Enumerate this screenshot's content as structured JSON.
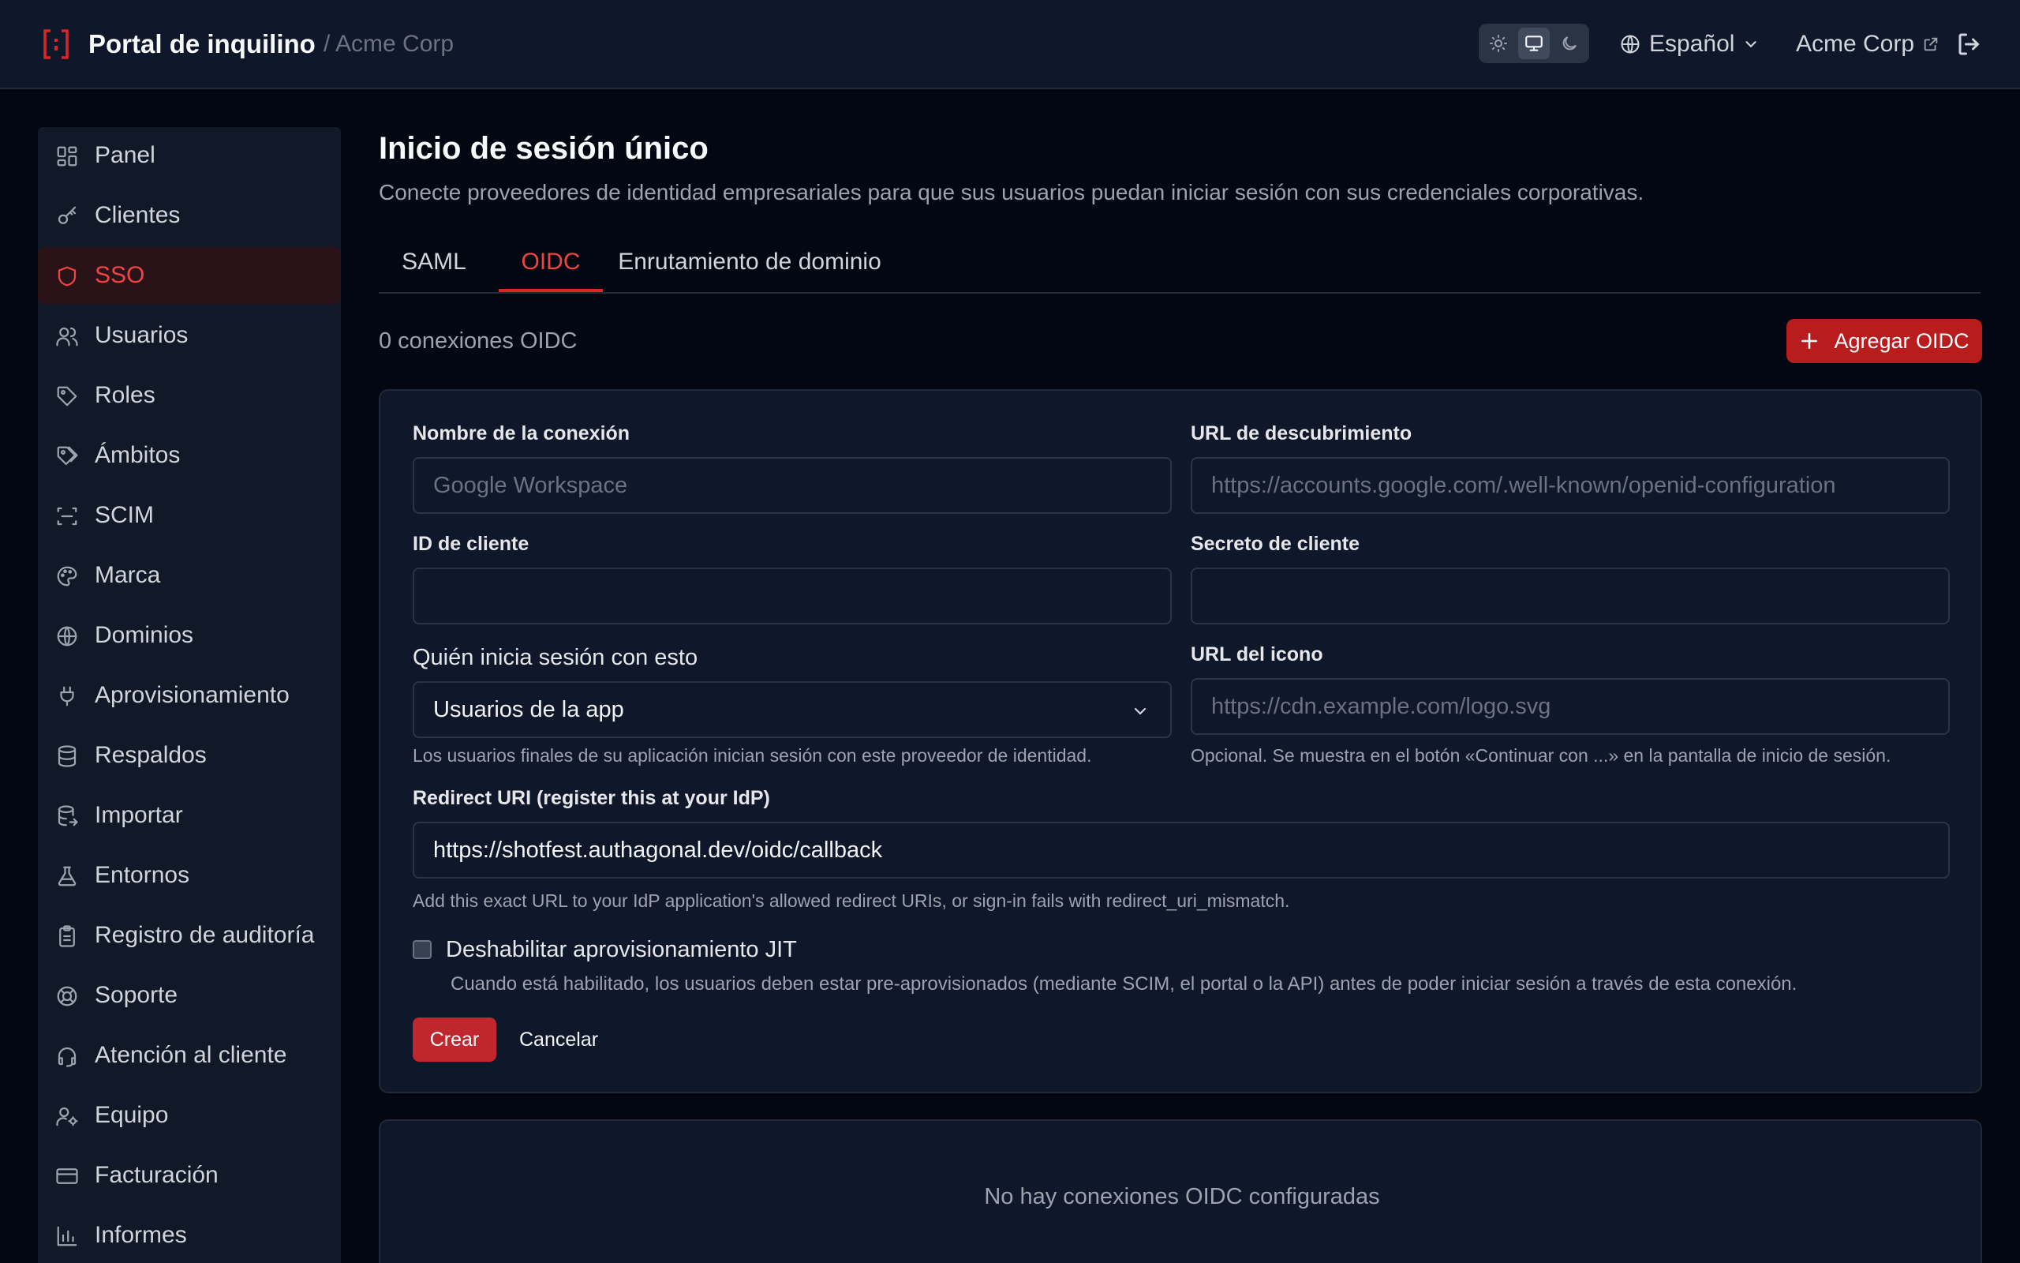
{
  "header": {
    "title": "Portal de inquilino",
    "breadcrumb": "/ Acme Corp",
    "theme_modes": [
      "light",
      "system",
      "dark"
    ],
    "theme_active": "system",
    "language": "Español",
    "org_name": "Acme Corp"
  },
  "sidebar": {
    "items": [
      {
        "label": "Panel",
        "icon": "dashboard-icon"
      },
      {
        "label": "Clientes",
        "icon": "key-icon"
      },
      {
        "label": "SSO",
        "icon": "shield-icon",
        "active": true
      },
      {
        "label": "Usuarios",
        "icon": "users-icon"
      },
      {
        "label": "Roles",
        "icon": "tag-icon"
      },
      {
        "label": "Ámbitos",
        "icon": "tags-icon"
      },
      {
        "label": "SCIM",
        "icon": "scan-icon"
      },
      {
        "label": "Marca",
        "icon": "palette-icon"
      },
      {
        "label": "Dominios",
        "icon": "globe-icon"
      },
      {
        "label": "Aprovisionamiento",
        "icon": "plug-icon"
      },
      {
        "label": "Respaldos",
        "icon": "database-icon"
      },
      {
        "label": "Importar",
        "icon": "database-import-icon"
      },
      {
        "label": "Entornos",
        "icon": "flask-icon"
      },
      {
        "label": "Registro de auditoría",
        "icon": "clipboard-icon"
      },
      {
        "label": "Soporte",
        "icon": "lifebuoy-icon"
      },
      {
        "label": "Atención al cliente",
        "icon": "headset-icon"
      },
      {
        "label": "Equipo",
        "icon": "user-gear-icon"
      },
      {
        "label": "Facturación",
        "icon": "credit-card-icon"
      },
      {
        "label": "Informes",
        "icon": "chart-icon"
      }
    ]
  },
  "page": {
    "title": "Inicio de sesión único",
    "description": "Conecte proveedores de identidad empresariales para que sus usuarios puedan iniciar sesión con sus credenciales corporativas.",
    "tabs": [
      "SAML",
      "OIDC",
      "Enrutamiento de dominio"
    ],
    "active_tab": "OIDC",
    "count_text": "0 conexiones OIDC",
    "add_button": "Agregar OIDC"
  },
  "form": {
    "connection_name_label": "Nombre de la conexión",
    "connection_name_placeholder": "Google Workspace",
    "discovery_url_label": "URL de descubrimiento",
    "discovery_url_placeholder": "https://accounts.google.com/.well-known/openid-configuration",
    "client_id_label": "ID de cliente",
    "client_id_value": "",
    "client_secret_label": "Secreto de cliente",
    "client_secret_value": "",
    "who_signs_in_label": "Quién inicia sesión con esto",
    "who_signs_in_value": "Usuarios de la app",
    "who_signs_in_help": "Los usuarios finales de su aplicación inician sesión con este proveedor de identidad.",
    "icon_url_label": "URL del icono",
    "icon_url_placeholder": "https://cdn.example.com/logo.svg",
    "icon_url_help": "Opcional. Se muestra en el botón «Continuar con ...» en la pantalla de inicio de sesión.",
    "redirect_label": "Redirect URI (register this at your IdP)",
    "redirect_value": "https://shotfest.authagonal.dev/oidc/callback",
    "redirect_help": "Add this exact URL to your IdP application's allowed redirect URIs, or sign-in fails with redirect_uri_mismatch.",
    "jit_label": "Deshabilitar aprovisionamiento JIT",
    "jit_checked": false,
    "jit_help": "Cuando está habilitado, los usuarios deben estar pre-aprovisionados (mediante SCIM, el portal o la API) antes de poder iniciar sesión a través de esta conexión.",
    "create_button": "Crear",
    "cancel_button": "Cancelar"
  },
  "empty_state": {
    "text": "No hay conexiones OIDC configuradas"
  },
  "colors": {
    "accent": "#dc2626",
    "background": "#030712",
    "surface": "#0f172a",
    "border": "#1f2937"
  }
}
